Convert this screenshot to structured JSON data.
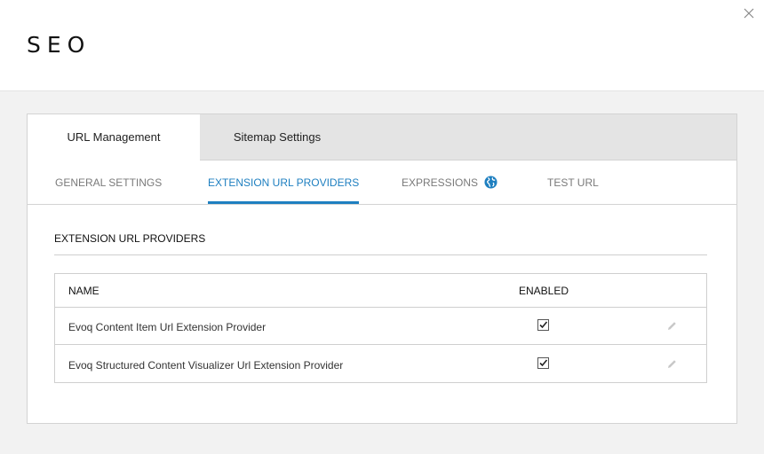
{
  "page": {
    "title": "SEO"
  },
  "close_icon": "close-icon",
  "tabs": [
    {
      "label": "URL Management",
      "active": true
    },
    {
      "label": "Sitemap Settings",
      "active": false
    }
  ],
  "subtabs": [
    {
      "label": "GENERAL SETTINGS",
      "active": false
    },
    {
      "label": "EXTENSION URL PROVIDERS",
      "active": true
    },
    {
      "label": "EXPRESSIONS",
      "active": false,
      "icon": "globe-icon"
    },
    {
      "label": "TEST URL",
      "active": false
    }
  ],
  "section": {
    "title": "EXTENSION URL PROVIDERS"
  },
  "grid": {
    "columns": {
      "name": "NAME",
      "enabled": "ENABLED"
    },
    "rows": [
      {
        "name": "Evoq Content Item Url Extension Provider",
        "enabled": true,
        "edit_icon": "pencil-icon"
      },
      {
        "name": "Evoq Structured Content Visualizer Url Extension Provider",
        "enabled": true,
        "edit_icon": "pencil-icon"
      }
    ]
  },
  "colors": {
    "accent": "#1e7fc0",
    "tab_bar": "#e4e4e4",
    "muted_text": "#7a7a7a"
  }
}
